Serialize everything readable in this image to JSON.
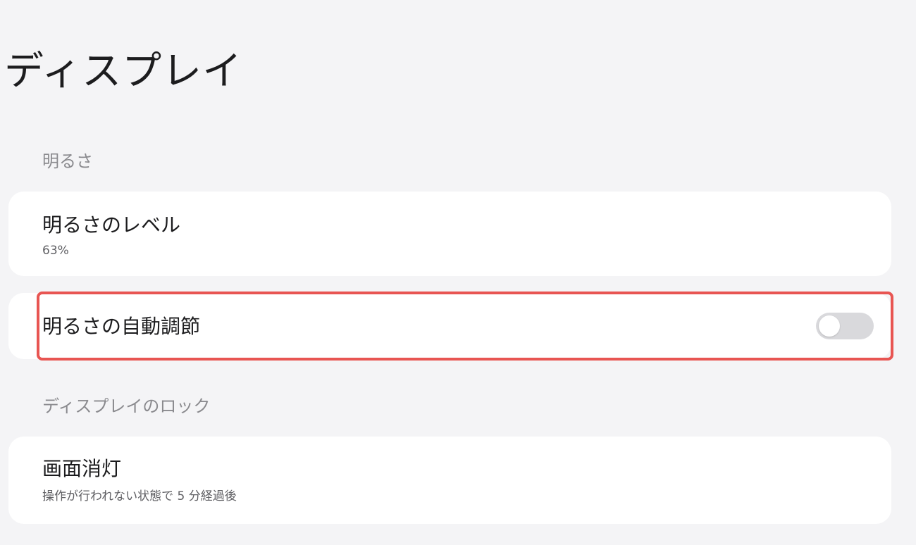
{
  "page": {
    "title": "ディスプレイ"
  },
  "sections": {
    "brightness": {
      "header": "明るさ",
      "level": {
        "title": "明るさのレベル",
        "value": "63%"
      },
      "auto": {
        "title": "明るさの自動調節",
        "toggle_on": false
      }
    },
    "lock": {
      "header": "ディスプレイのロック",
      "screen_off": {
        "title": "画面消灯",
        "subtitle": "操作が行われない状態で 5 分経過後"
      }
    }
  },
  "colors": {
    "background": "#f4f4f6",
    "card": "#ffffff",
    "highlight_border": "#e85552",
    "toggle_off_track": "#d9d9dc"
  }
}
